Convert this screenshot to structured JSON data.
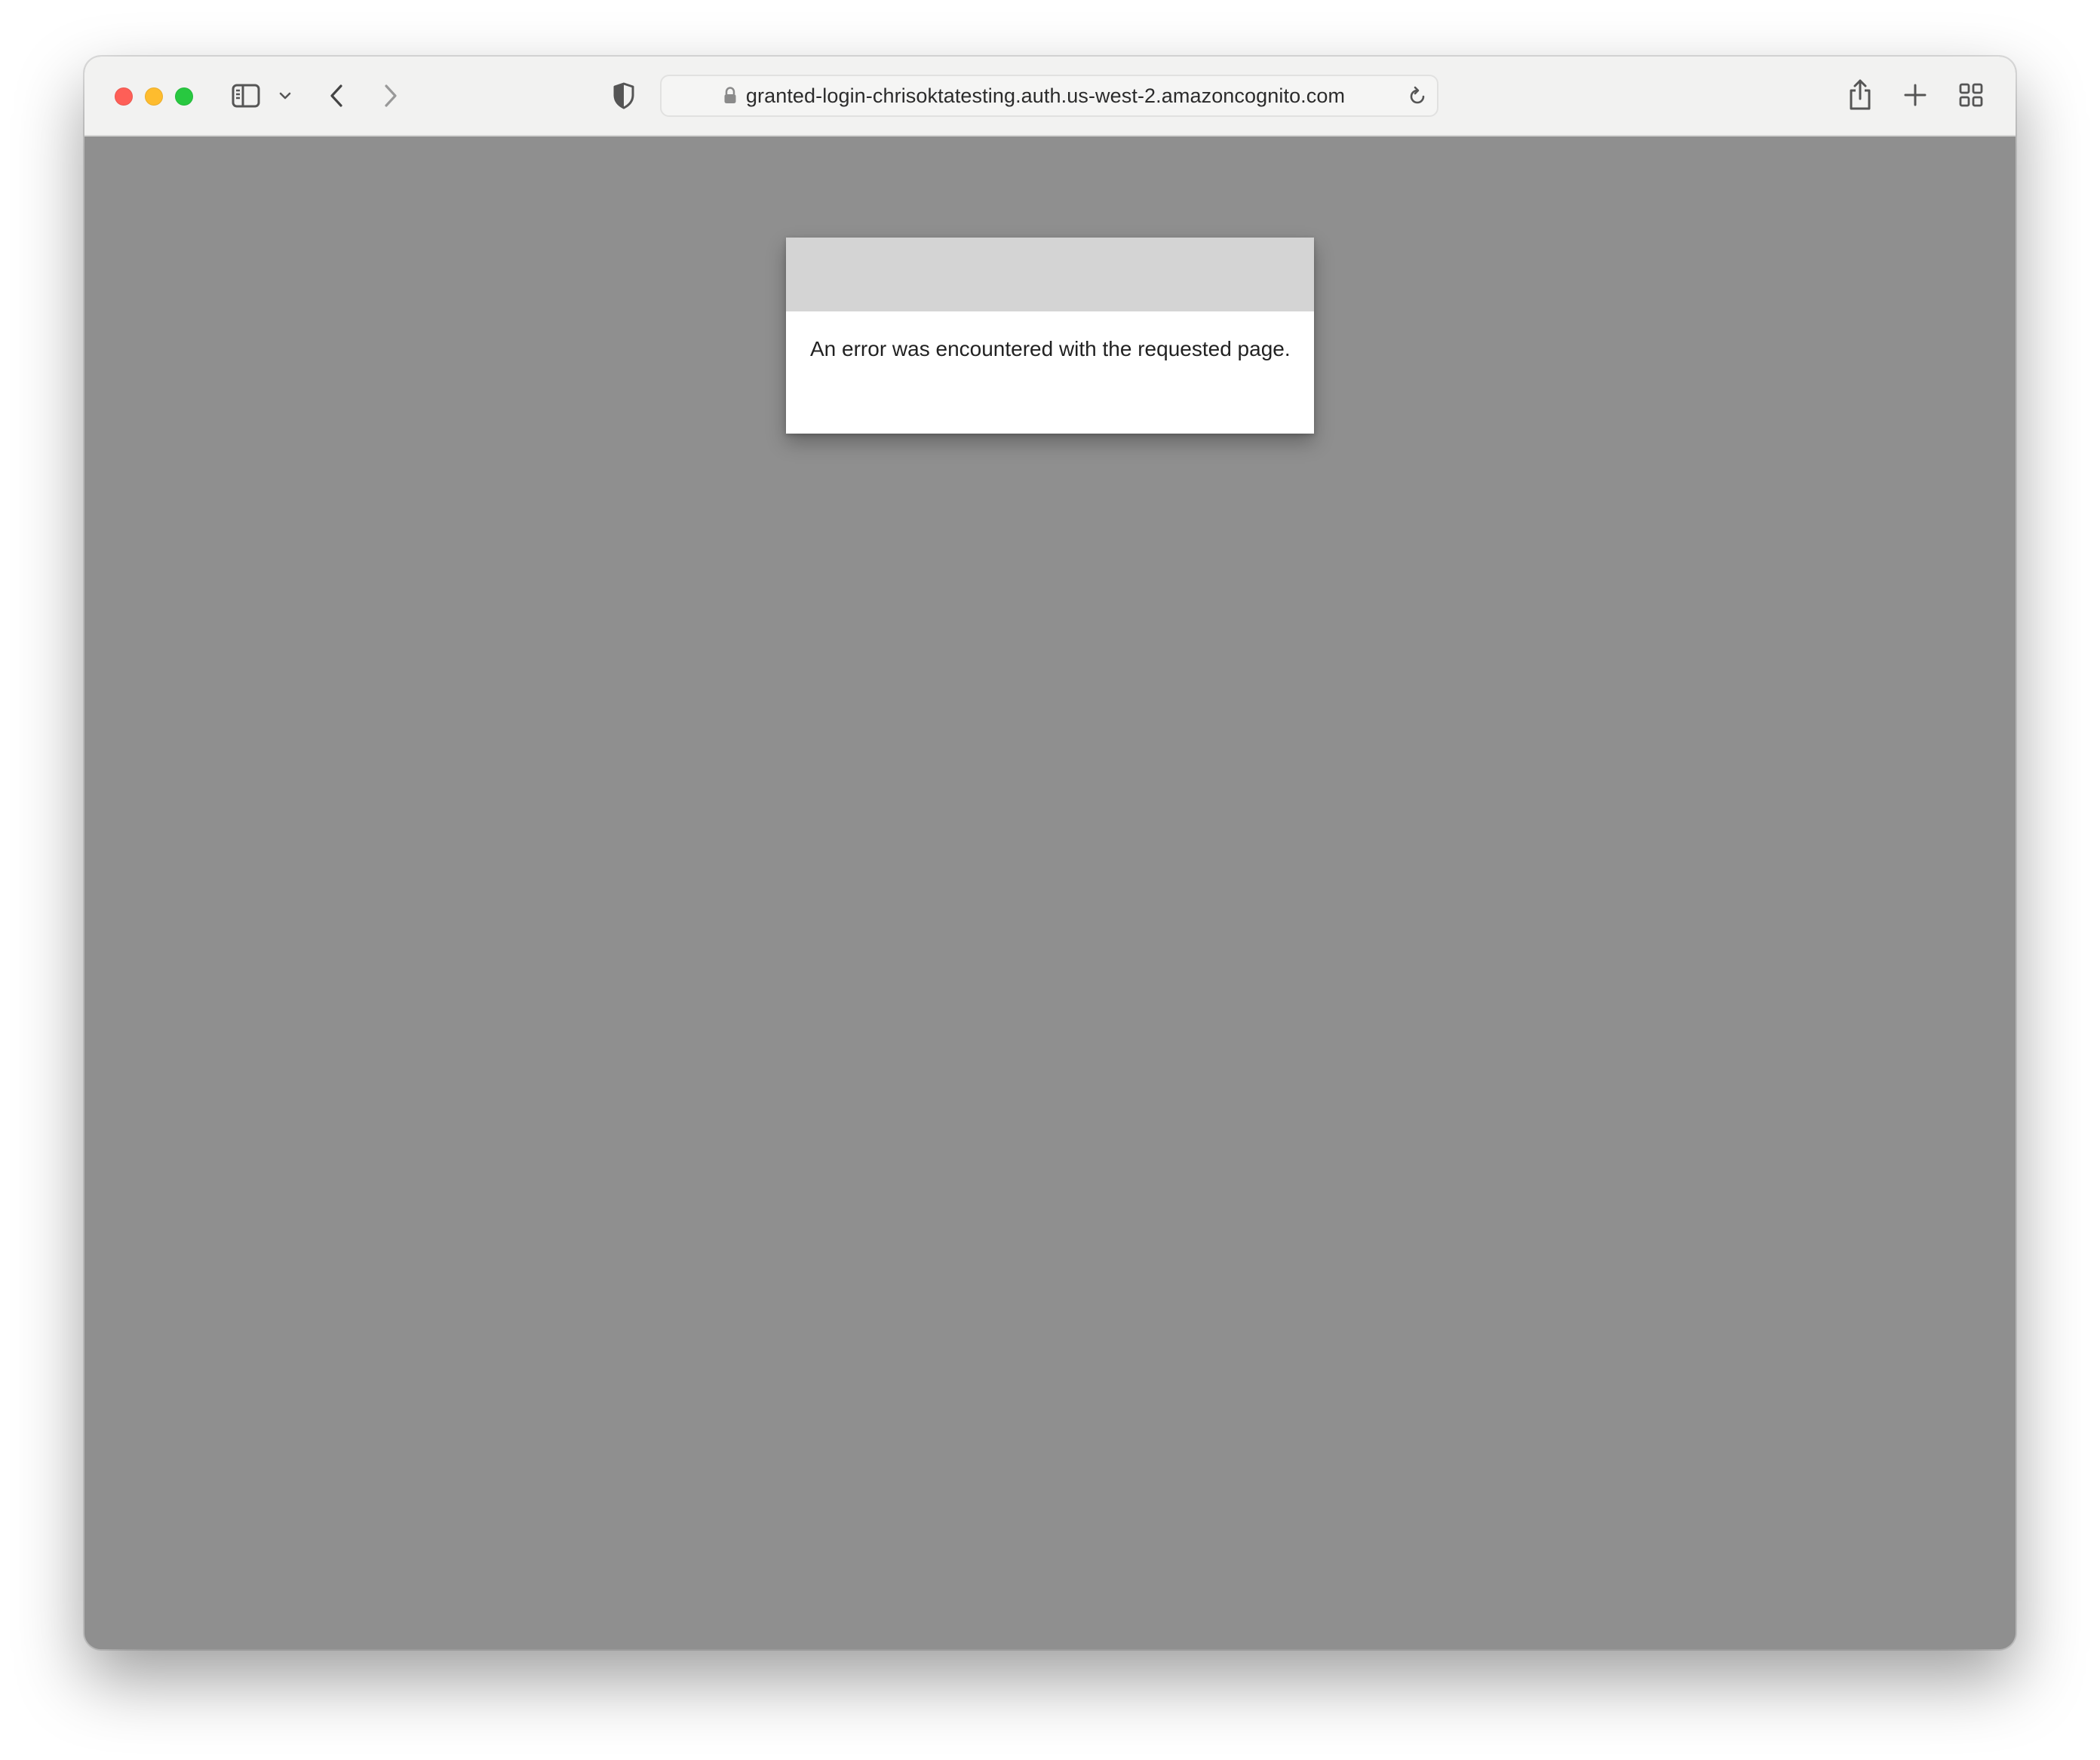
{
  "browser": {
    "address_bar": {
      "url": "granted-login-chrisoktatesting.auth.us-west-2.amazoncognito.com",
      "secure": true
    },
    "icons": {
      "close": "close-window-button",
      "minimize": "minimize-window-button",
      "maximize": "fullscreen-window-button",
      "sidebar": "sidebar-icon",
      "sidebar_menu": "chevron-down-icon",
      "back": "back-arrow-icon",
      "forward": "forward-arrow-icon",
      "privacy": "shield-icon",
      "lock": "lock-icon",
      "reload": "reload-icon",
      "share": "share-icon",
      "new_tab": "plus-icon",
      "tab_overview": "grid-icon"
    },
    "colors": {
      "close": "#fe5f57",
      "minimize": "#febc2e",
      "maximize": "#28c840",
      "page_background": "#8f8f8f"
    }
  },
  "page": {
    "error_message": "An error was encountered with the requested page."
  }
}
